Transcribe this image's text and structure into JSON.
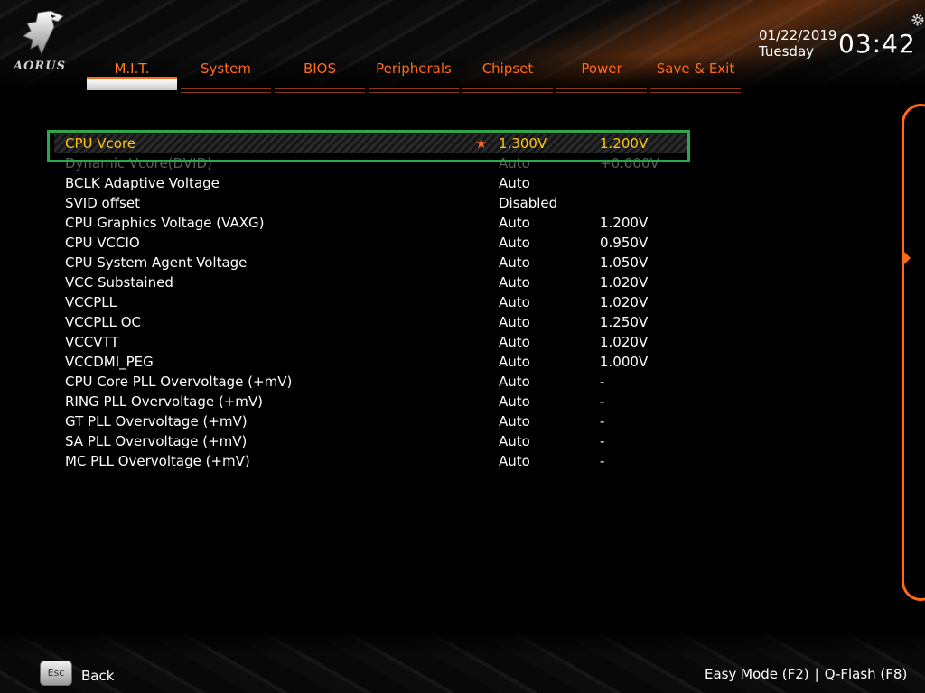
{
  "brand": {
    "logo_text": "AORUS"
  },
  "tabs": [
    {
      "label": "M.I.T.",
      "active": true
    },
    {
      "label": "System"
    },
    {
      "label": "BIOS"
    },
    {
      "label": "Peripherals"
    },
    {
      "label": "Chipset"
    },
    {
      "label": "Power"
    },
    {
      "label": "Save & Exit"
    }
  ],
  "datetime": {
    "date": "01/22/2019",
    "day": "Tuesday",
    "time": "03:42"
  },
  "settings": [
    {
      "label": "CPU Vcore",
      "value": "1.300V",
      "current": "1.200V",
      "selected": true
    },
    {
      "label": "Dynamic Vcore(DVID)",
      "value": "Auto",
      "current": "+0.000V"
    },
    {
      "label": "BCLK Adaptive Voltage",
      "value": "Auto",
      "current": ""
    },
    {
      "label": "SVID offset",
      "value": "Disabled",
      "current": ""
    },
    {
      "label": "CPU Graphics Voltage (VAXG)",
      "value": "Auto",
      "current": "1.200V"
    },
    {
      "label": "CPU VCCIO",
      "value": "Auto",
      "current": "0.950V"
    },
    {
      "label": "CPU System Agent Voltage",
      "value": "Auto",
      "current": "1.050V"
    },
    {
      "label": "VCC Substained",
      "value": "Auto",
      "current": "1.020V"
    },
    {
      "label": "VCCPLL",
      "value": "Auto",
      "current": "1.020V"
    },
    {
      "label": "VCCPLL OC",
      "value": "Auto",
      "current": "1.250V"
    },
    {
      "label": "VCCVTT",
      "value": "Auto",
      "current": "1.020V"
    },
    {
      "label": "VCCDMI_PEG",
      "value": "Auto",
      "current": "1.000V"
    },
    {
      "label": "CPU Core PLL Overvoltage (+mV)",
      "value": "Auto",
      "current": "-"
    },
    {
      "label": "RING PLL Overvoltage (+mV)",
      "value": "Auto",
      "current": "-"
    },
    {
      "label": "GT PLL Overvoltage (+mV)",
      "value": "Auto",
      "current": "-"
    },
    {
      "label": "SA PLL Overvoltage (+mV)",
      "value": "Auto",
      "current": "-"
    },
    {
      "label": "MC PLL Overvoltage (+mV)",
      "value": "Auto",
      "current": "-"
    }
  ],
  "footer": {
    "esc_key": "Esc",
    "back_label": "Back",
    "easy_mode": "Easy Mode (F2)",
    "separator": "|",
    "qflash": "Q-Flash (F8)"
  },
  "colors": {
    "accent": "#ff6a1a",
    "selected_text": "#ffc21a",
    "highlight_box": "#2aa84a",
    "text": "#ffffff"
  },
  "icons": {
    "star": "star-icon",
    "gear": "gear-icon",
    "panel_arrow": "chevron-right-icon"
  }
}
